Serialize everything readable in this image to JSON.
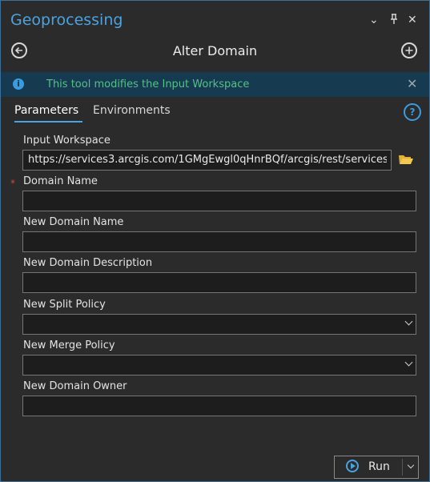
{
  "window": {
    "title": "Geoprocessing",
    "controls": {
      "menu": "⌄",
      "pin": "ᵽ",
      "close": "✕"
    }
  },
  "tool": {
    "title": "Alter Domain",
    "back_icon": "back-arrow-icon",
    "add_icon": "plus-circle-icon"
  },
  "info": {
    "message": "This tool modifies the Input Workspace",
    "close": "✕"
  },
  "tabs": [
    {
      "label": "Parameters",
      "active": true
    },
    {
      "label": "Environments",
      "active": false
    }
  ],
  "help": "?",
  "params": {
    "input_workspace": {
      "label": "Input Workspace",
      "value": "https://services3.arcgis.com/1GMgEwgl0qHnrBQf/arcgis/rest/services"
    },
    "domain_name": {
      "label": "Domain Name",
      "required_mark": "*",
      "value": ""
    },
    "new_domain_name": {
      "label": "New Domain Name",
      "value": ""
    },
    "new_domain_description": {
      "label": "New Domain Description",
      "value": ""
    },
    "new_split_policy": {
      "label": "New Split Policy",
      "value": ""
    },
    "new_merge_policy": {
      "label": "New Merge Policy",
      "value": ""
    },
    "new_domain_owner": {
      "label": "New Domain Owner",
      "value": ""
    }
  },
  "run": {
    "label": "Run"
  },
  "colors": {
    "accent": "#4aa3e0",
    "info_bg": "#163a4f",
    "info_text": "#55c08a",
    "required": "#d04a3a"
  }
}
